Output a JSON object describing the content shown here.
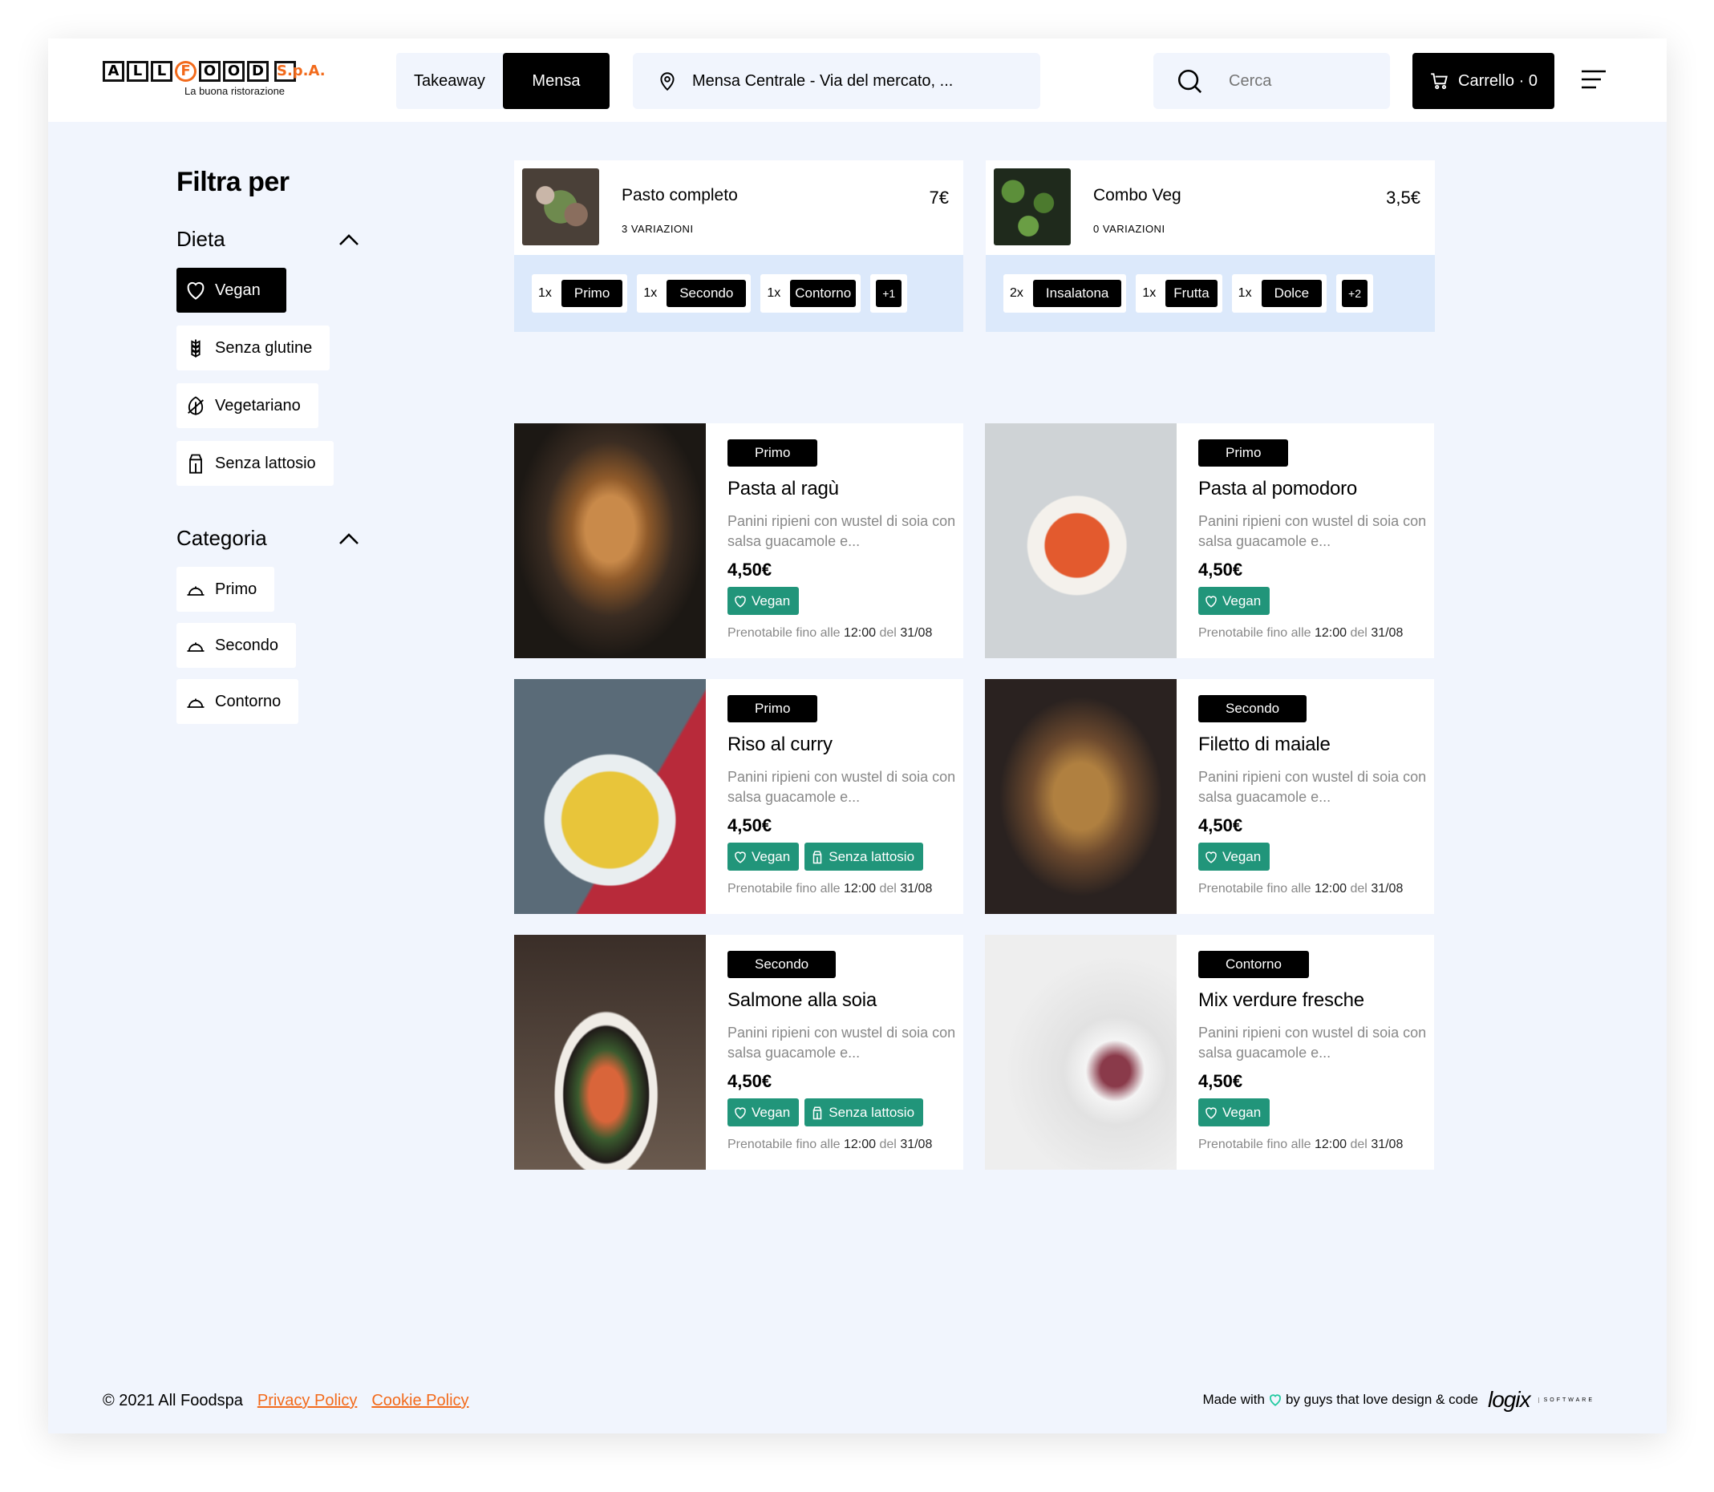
{
  "brand": {
    "letters": [
      "A",
      "L",
      "L",
      "F",
      "O",
      "O",
      "D"
    ],
    "spa": "S.p.A.",
    "tagline": "La buona ristorazione"
  },
  "mode": {
    "takeaway": "Takeaway",
    "mensa": "Mensa"
  },
  "location": {
    "text": "Mensa Centrale - Via del mercato, ..."
  },
  "search": {
    "placeholder": "Cerca"
  },
  "cart": {
    "label": "Carrello · 0"
  },
  "sidebar": {
    "title": "Filtra per",
    "diet_heading": "Dieta",
    "diet": [
      "Vegan",
      "Senza glutine",
      "Vegetariano",
      "Senza lattosio"
    ],
    "category_heading": "Categoria",
    "categories": [
      "Primo",
      "Secondo",
      "Contorno"
    ]
  },
  "combos": [
    {
      "name": "Pasto completo",
      "price": "7€",
      "variations": "3 VARIAZIONI",
      "items": [
        {
          "qty": "1x",
          "label": "Primo"
        },
        {
          "qty": "1x",
          "label": "Secondo"
        },
        {
          "qty": "1x",
          "label": "Contorno"
        }
      ],
      "more": "+1"
    },
    {
      "name": "Combo Veg",
      "price": "3,5€",
      "variations": "0 VARIAZIONI",
      "items": [
        {
          "qty": "2x",
          "label": "Insalatona"
        },
        {
          "qty": "1x",
          "label": "Frutta"
        },
        {
          "qty": "1x",
          "label": "Dolce"
        }
      ],
      "more": "+2"
    }
  ],
  "dishes": [
    {
      "category": "Primo",
      "title": "Pasta al ragù",
      "desc": "Panini ripieni con wustel di soia con salsa guacamole e...",
      "price": "4,50€",
      "badges": [
        "Vegan"
      ],
      "avail_prefix": "Prenotabile fino alle",
      "time": "12:00",
      "del": "del",
      "date": "31/08"
    },
    {
      "category": "Primo",
      "title": "Pasta al pomodoro",
      "desc": "Panini ripieni con wustel di soia con salsa guacamole e...",
      "price": "4,50€",
      "badges": [
        "Vegan"
      ],
      "avail_prefix": "Prenotabile fino alle",
      "time": "12:00",
      "del": "del",
      "date": "31/08"
    },
    {
      "category": "Primo",
      "title": "Riso al curry",
      "desc": "Panini ripieni con wustel di soia con salsa guacamole e...",
      "price": "4,50€",
      "badges": [
        "Vegan",
        "Senza lattosio"
      ],
      "avail_prefix": "Prenotabile fino alle",
      "time": "12:00",
      "del": "del",
      "date": "31/08"
    },
    {
      "category": "Secondo",
      "title": "Filetto di maiale",
      "desc": "Panini ripieni con wustel di soia con salsa guacamole e...",
      "price": "4,50€",
      "badges": [
        "Vegan"
      ],
      "avail_prefix": "Prenotabile fino alle",
      "time": "12:00",
      "del": "del",
      "date": "31/08"
    },
    {
      "category": "Secondo",
      "title": "Salmone alla soia",
      "desc": "Panini ripieni con wustel di soia con salsa guacamole e...",
      "price": "4,50€",
      "badges": [
        "Vegan",
        "Senza lattosio"
      ],
      "avail_prefix": "Prenotabile fino alle",
      "time": "12:00",
      "del": "del",
      "date": "31/08"
    },
    {
      "category": "Contorno",
      "title": "Mix verdure fresche",
      "desc": "Panini ripieni con wustel di soia con salsa guacamole e...",
      "price": "4,50€",
      "badges": [
        "Vegan"
      ],
      "avail_prefix": "Prenotabile fino alle",
      "time": "12:00",
      "del": "del",
      "date": "31/08"
    }
  ],
  "footer": {
    "copyright": "© 2021 All Foodspa",
    "privacy": "Privacy Policy",
    "cookie": "Cookie Policy"
  },
  "credits": {
    "made_with": "Made with",
    "by": "by guys that love design & code",
    "logo": "logix",
    "logo_sub": "SOFTWARE"
  },
  "colors": {
    "accent": "#f26a1b",
    "badge_green": "#21957a",
    "combo_items_bg": "#dce9fb",
    "page_bg": "#f1f5fd",
    "black": "#000000"
  }
}
